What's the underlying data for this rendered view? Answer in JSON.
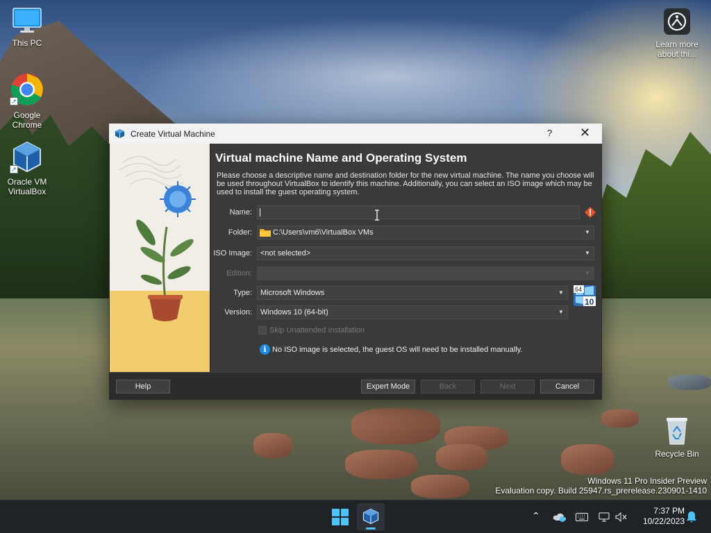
{
  "desktop": {
    "icons": [
      {
        "label": "This PC",
        "icon": "monitor-icon"
      },
      {
        "label": "Google Chrome",
        "icon": "chrome-icon"
      },
      {
        "label": "Oracle VM VirtualBox",
        "icon": "virtualbox-icon"
      },
      {
        "label": "Learn more about thi...",
        "icon": "learn-more-icon"
      },
      {
        "label": "Recycle Bin",
        "icon": "recycle-bin-icon"
      }
    ],
    "watermark": {
      "line1": "Windows 11 Pro Insider Preview",
      "line2": "Evaluation copy. Build 25947.rs_prerelease.230901-1410"
    }
  },
  "dialog": {
    "window_title": "Create Virtual Machine",
    "help_glyph": "?",
    "close_glyph": "✕",
    "heading": "Virtual machine Name and Operating System",
    "intro": "Please choose a descriptive name and destination folder for the new virtual machine. The name you choose will be used throughout VirtualBox to identify this machine. Additionally, you can select an ISO image which may be used to install the guest operating system.",
    "fields": {
      "name": {
        "label": "Name:",
        "value": ""
      },
      "folder": {
        "label": "Folder:",
        "value": "C:\\Users\\vm6\\VirtualBox VMs"
      },
      "iso": {
        "label": "ISO Image:",
        "value": "<not selected>"
      },
      "edition": {
        "label": "Edition:",
        "value": ""
      },
      "type": {
        "label": "Type:",
        "value": "Microsoft Windows"
      },
      "version": {
        "label": "Version:",
        "value": "Windows 10 (64-bit)"
      }
    },
    "os_badge": {
      "bits": "64",
      "version": "10"
    },
    "unattended_label": "Skip Unattended Installation",
    "unattended_checked": false,
    "info_note": "No ISO image is selected, the guest OS will need to be installed manually.",
    "buttons": {
      "help": "Help",
      "expert": "Expert Mode",
      "back": "Back",
      "next": "Next",
      "cancel": "Cancel"
    },
    "colors": {
      "accent": "#1f8ae6",
      "warning": "#e8562a"
    }
  },
  "taskbar": {
    "time": "7:37 PM",
    "date": "10/22/2023",
    "tray_icons": [
      "chevron-up-icon",
      "onedrive-icon",
      "keyboard-icon",
      "network-icon",
      "volume-muted-icon",
      "notification-bell-icon"
    ]
  }
}
